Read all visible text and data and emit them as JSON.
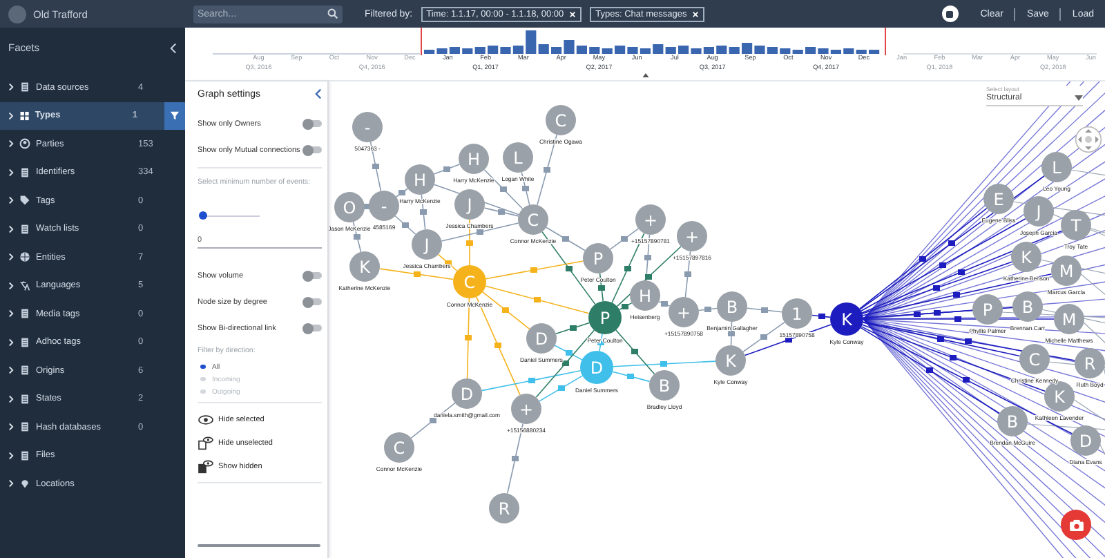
{
  "header": {
    "account": "Old Trafford",
    "search": {
      "placeholder": "Search..."
    },
    "filter_label": "Filtered by:",
    "filters": [
      "Time: 1.1.17, 00:00 - 1.1.18, 00:00",
      "Types: Chat messages"
    ],
    "actions": [
      "Clear",
      "Save",
      "Load"
    ]
  },
  "timeline": {
    "months": [
      {
        "label": "Aug",
        "quarter": "Q3, 2016",
        "in_range": false
      },
      {
        "label": "Sep",
        "in_range": false
      },
      {
        "label": "Oct",
        "in_range": false
      },
      {
        "label": "Nov",
        "quarter": "Q4, 2016",
        "in_range": false
      },
      {
        "label": "Dec",
        "in_range": false
      },
      {
        "label": "Jan",
        "in_range": true
      },
      {
        "label": "Feb",
        "quarter": "Q1, 2017",
        "in_range": true
      },
      {
        "label": "Mar",
        "in_range": true
      },
      {
        "label": "Apr",
        "in_range": true
      },
      {
        "label": "May",
        "quarter": "Q2, 2017",
        "in_range": true
      },
      {
        "label": "Jun",
        "in_range": true
      },
      {
        "label": "Jul",
        "in_range": true
      },
      {
        "label": "Aug",
        "quarter": "Q3, 2017",
        "in_range": true
      },
      {
        "label": "Sep",
        "in_range": true
      },
      {
        "label": "Oct",
        "in_range": true
      },
      {
        "label": "Nov",
        "quarter": "Q4, 2017",
        "in_range": true
      },
      {
        "label": "Dec",
        "in_range": true
      },
      {
        "label": "Jan",
        "in_range": false
      },
      {
        "label": "Feb",
        "quarter": "Q1, 2018",
        "in_range": false
      },
      {
        "label": "Mar",
        "in_range": false
      },
      {
        "label": "Apr",
        "in_range": false
      },
      {
        "label": "May",
        "quarter": "Q2, 2018",
        "in_range": false
      },
      {
        "label": "Jun",
        "in_range": false
      }
    ]
  },
  "sidebar": {
    "title": "Facets",
    "items": [
      {
        "label": "Data sources",
        "count": "4",
        "selected": false
      },
      {
        "label": "Types",
        "count": "1",
        "selected": true
      },
      {
        "label": "Parties",
        "count": "153",
        "selected": false
      },
      {
        "label": "Identifiers",
        "count": "334",
        "selected": false
      },
      {
        "label": "Tags",
        "count": "0",
        "selected": false
      },
      {
        "label": "Watch lists",
        "count": "0",
        "selected": false
      },
      {
        "label": "Entities",
        "count": "7",
        "selected": false
      },
      {
        "label": "Languages",
        "count": "5",
        "selected": false
      },
      {
        "label": "Media tags",
        "count": "0",
        "selected": false
      },
      {
        "label": "Adhoc tags",
        "count": "0",
        "selected": false
      },
      {
        "label": "Origins",
        "count": "6",
        "selected": false
      },
      {
        "label": "States",
        "count": "2",
        "selected": false
      },
      {
        "label": "Hash databases",
        "count": "0",
        "selected": false
      },
      {
        "label": "Files",
        "selected": false
      },
      {
        "label": "Locations",
        "selected": false
      }
    ]
  },
  "graph_settings": {
    "title": "Graph settings",
    "top_toggles": [
      {
        "label": "Show only Owners",
        "on": false
      },
      {
        "label": "Show only Mutual connections",
        "on": false
      }
    ],
    "min_events": {
      "label": "Select minimum number of events:",
      "level": 0.03,
      "value": "0"
    },
    "toggles": [
      {
        "label": "Show volume",
        "on": false
      },
      {
        "label": "Node size by degree",
        "on": false
      },
      {
        "label": "Show Bi-directional link",
        "on": false
      }
    ],
    "direction": {
      "label": "Filter by direction:",
      "options": [
        {
          "label": "All",
          "selected": true
        },
        {
          "label": "Incoming",
          "selected": false
        },
        {
          "label": "Outgoing",
          "selected": false
        }
      ]
    },
    "actions": [
      "Hide selected",
      "Hide unselected",
      "Show hidden"
    ]
  },
  "graph": {
    "layout": {
      "label": "Select layout",
      "value": "Structural"
    },
    "nodes": [
      {
        "letter": "-",
        "label": "5047363 -"
      },
      {
        "letter": "C",
        "label": "Christine Ogawa"
      },
      {
        "letter": "H",
        "label": "Harry McKenzie"
      },
      {
        "letter": "L",
        "label": "Logan White"
      },
      {
        "letter": "H",
        "label": "Harry McKenzie"
      },
      {
        "letter": "O",
        "label": "Jason McKenzie"
      },
      {
        "letter": "-",
        "label": "4585169"
      },
      {
        "letter": "J",
        "label": "Jessica Chambers"
      },
      {
        "letter": "C",
        "label": "Connor McKenzie"
      },
      {
        "letter": "J",
        "label": "Jessica Chambers"
      },
      {
        "letter": "K",
        "label": "Katherine McKenzie"
      },
      {
        "letter": "C",
        "label": "Connor McKenzie",
        "color": "#f5b21b"
      },
      {
        "letter": "+",
        "label": "+15157890781"
      },
      {
        "letter": "+",
        "label": "+15157897816"
      },
      {
        "letter": "P",
        "label": "Peter Coulton"
      },
      {
        "letter": "P",
        "label": "Peter Coulton",
        "color": "#2e7d66"
      },
      {
        "letter": "H",
        "label": "Heisenberg"
      },
      {
        "letter": "+",
        "label": "+15157890758"
      },
      {
        "letter": "B",
        "label": "Benjamin Gallagher"
      },
      {
        "letter": "1",
        "label": "15157890758"
      },
      {
        "letter": "K",
        "label": "Kyle Conway",
        "color": "#1d1dbf"
      },
      {
        "letter": "D",
        "label": "Daniel Summers"
      },
      {
        "letter": "D",
        "label": "Daniel Summers",
        "color": "#3fbfea"
      },
      {
        "letter": "K",
        "label": "Kyle Conway"
      },
      {
        "letter": "B",
        "label": "Bradley Lloyd"
      },
      {
        "letter": "D",
        "label": "daniela.smith@gmail.com"
      },
      {
        "letter": "+",
        "label": "+15156880234"
      },
      {
        "letter": "C",
        "label": "Connor McKenzie"
      },
      {
        "letter": "R"
      },
      {
        "letter": "L",
        "label": "Leo Young"
      },
      {
        "letter": "E",
        "label": "Eugene Bliss"
      },
      {
        "letter": "J",
        "label": "Joseph Garcia"
      },
      {
        "letter": "T",
        "label": "Troy Tate"
      },
      {
        "letter": "K",
        "label": "Katherine Benson"
      },
      {
        "letter": "M",
        "label": "Marcus Garcia"
      },
      {
        "letter": "P",
        "label": "Phyllis Palmer"
      },
      {
        "letter": "B",
        "label": "Brennan Carr"
      },
      {
        "letter": "M",
        "label": "Michelle Matthews"
      },
      {
        "letter": "C",
        "label": "Christine Kennedy"
      },
      {
        "letter": "R",
        "label": "Ruth Boyd"
      },
      {
        "letter": "K",
        "label": "Kathleen Lavender"
      },
      {
        "letter": "B",
        "label": "Brendan McGuire"
      },
      {
        "letter": "D",
        "label": "Diana Evans"
      }
    ]
  }
}
